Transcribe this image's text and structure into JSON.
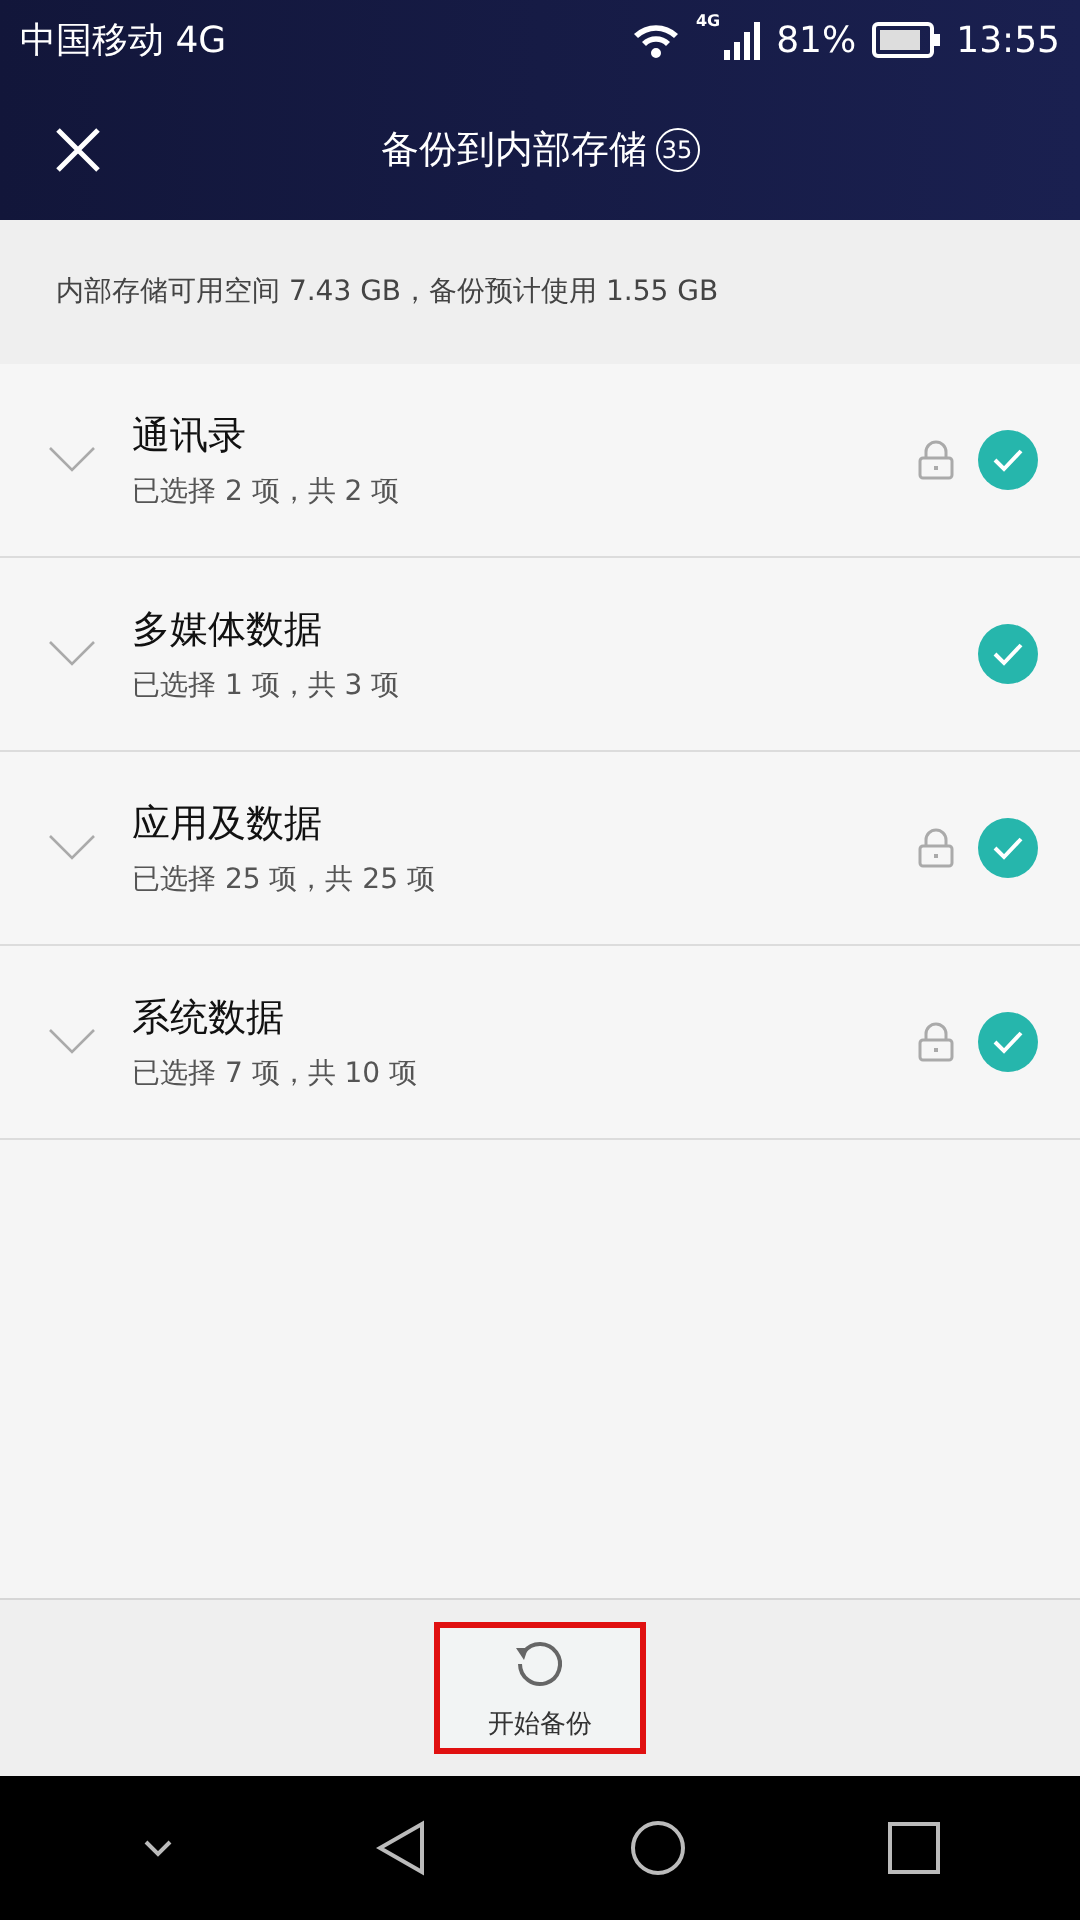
{
  "status_bar": {
    "carrier": "中国移动 4G",
    "network": "4G",
    "battery": "81%",
    "time": "13:55"
  },
  "toolbar": {
    "title": "备份到内部存储",
    "count": "35"
  },
  "storage_info": "内部存储可用空间 7.43 GB，备份预计使用 1.55 GB",
  "categories": [
    {
      "name": "通讯录",
      "summary": "已选择 2 项，共 2 项",
      "locked": true,
      "checked": true
    },
    {
      "name": "多媒体数据",
      "summary": "已选择 1 项，共 3 项",
      "locked": false,
      "checked": true
    },
    {
      "name": "应用及数据",
      "summary": "已选择 25 项，共 25 项",
      "locked": true,
      "checked": true
    },
    {
      "name": "系统数据",
      "summary": "已选择 7 项，共 10 项",
      "locked": true,
      "checked": true
    }
  ],
  "start_button": {
    "label": "开始备份",
    "highlighted": true
  }
}
